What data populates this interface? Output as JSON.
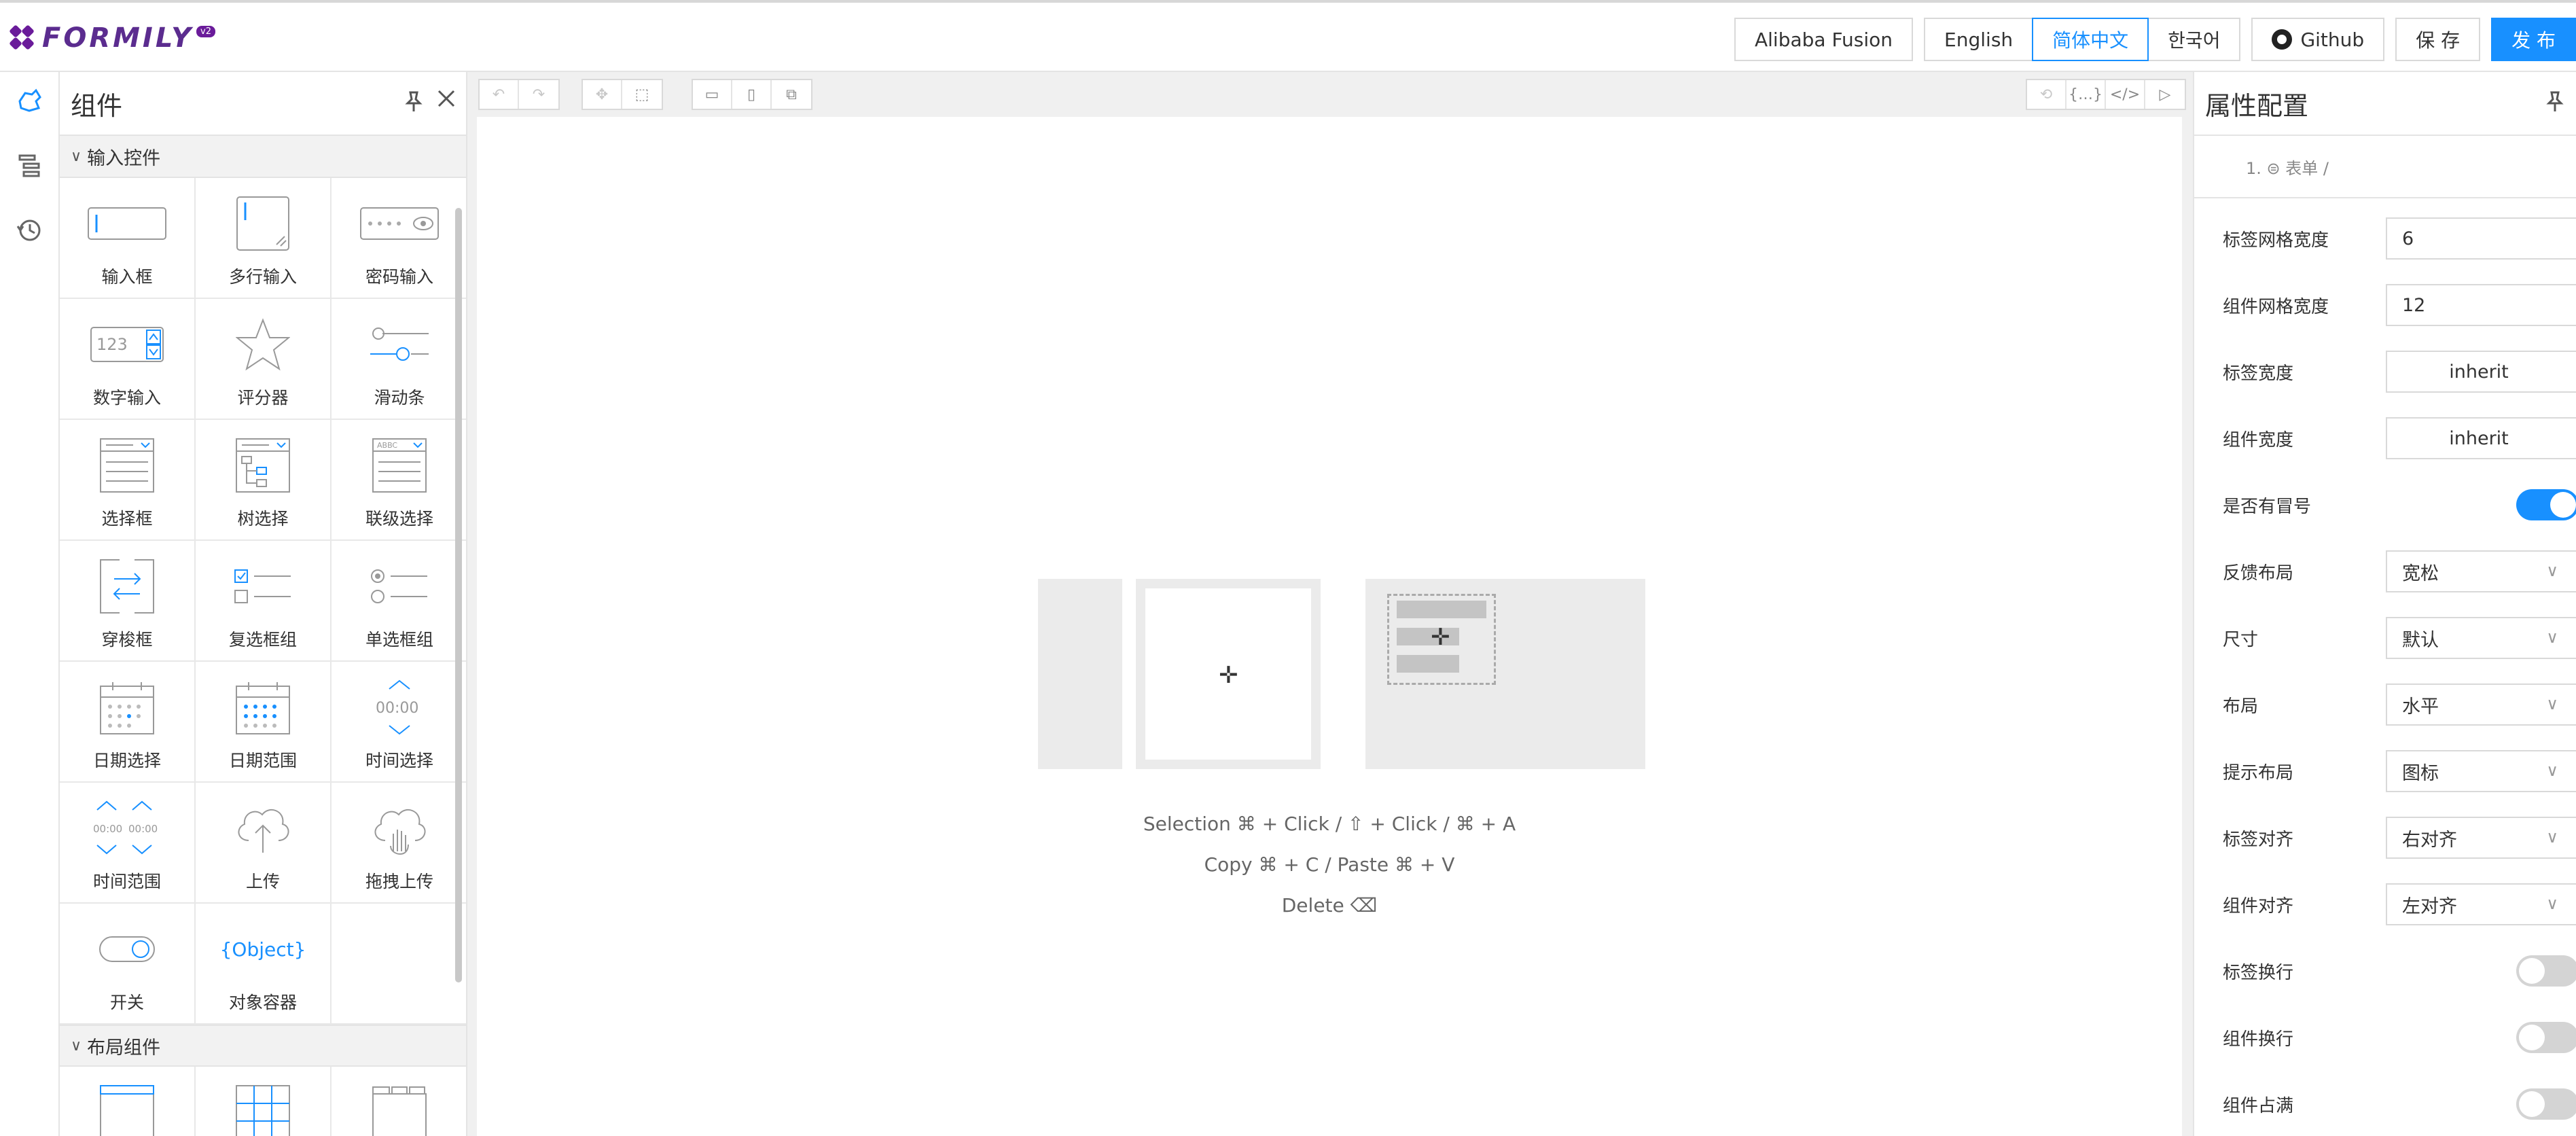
{
  "header": {
    "logo_text": "FORMILY",
    "logo_badge": "v2",
    "buttons": {
      "fusion": "Alibaba Fusion",
      "english": "English",
      "chinese": "简体中文",
      "korean": "한국어",
      "github": "Github",
      "save": "保 存",
      "publish": "发 布"
    }
  },
  "rail": {
    "icons": [
      "component-icon",
      "outline-tree-icon",
      "history-icon"
    ]
  },
  "components_panel": {
    "title": "组件",
    "groups": [
      {
        "title": "输入控件",
        "items": [
          "输入框",
          "多行输入",
          "密码输入",
          "数字输入",
          "评分器",
          "滑动条",
          "选择框",
          "树选择",
          "联级选择",
          "穿梭框",
          "复选框组",
          "单选框组",
          "日期选择",
          "日期范围",
          "时间选择",
          "时间范围",
          "上传",
          "拖拽上传",
          "开关",
          "对象容器"
        ]
      },
      {
        "title": "布局组件",
        "items": []
      }
    ],
    "icon_texts": {
      "number": "123",
      "time": "00:00",
      "time_range_a": "00:00",
      "time_range_b": "00:00",
      "object": "{Object}",
      "cascader": "ABBC"
    }
  },
  "canvas": {
    "hints": {
      "selection": "Selection ⌘ + Click / ⇧ + Click / ⌘ + A",
      "copy": "Copy ⌘ + C / Paste ⌘ + V",
      "delete": "Delete ⌫"
    }
  },
  "props_panel": {
    "title": "属性配置",
    "breadcrumb": "1. ⊜ 表单 /",
    "props": [
      {
        "label": "标签网格宽度",
        "value": "6",
        "kind": "input"
      },
      {
        "label": "组件网格宽度",
        "value": "12",
        "kind": "input"
      },
      {
        "label": "标签宽度",
        "value": "inherit",
        "kind": "center"
      },
      {
        "label": "组件宽度",
        "value": "inherit",
        "kind": "center"
      },
      {
        "label": "是否有冒号",
        "value": "",
        "kind": "toggle-on"
      },
      {
        "label": "反馈布局",
        "value": "宽松",
        "kind": "select"
      },
      {
        "label": "尺寸",
        "value": "默认",
        "kind": "select"
      },
      {
        "label": "布局",
        "value": "水平",
        "kind": "select"
      },
      {
        "label": "提示布局",
        "value": "图标",
        "kind": "select"
      },
      {
        "label": "标签对齐",
        "value": "右对齐",
        "kind": "select"
      },
      {
        "label": "组件对齐",
        "value": "左对齐",
        "kind": "select"
      },
      {
        "label": "标签换行",
        "value": "",
        "kind": "toggle-off"
      },
      {
        "label": "组件换行",
        "value": "",
        "kind": "toggle-off"
      },
      {
        "label": "组件占满",
        "value": "",
        "kind": "toggle-off"
      }
    ]
  },
  "colors": {
    "accent": "#1890ff",
    "brand": "#6a1b9a"
  }
}
